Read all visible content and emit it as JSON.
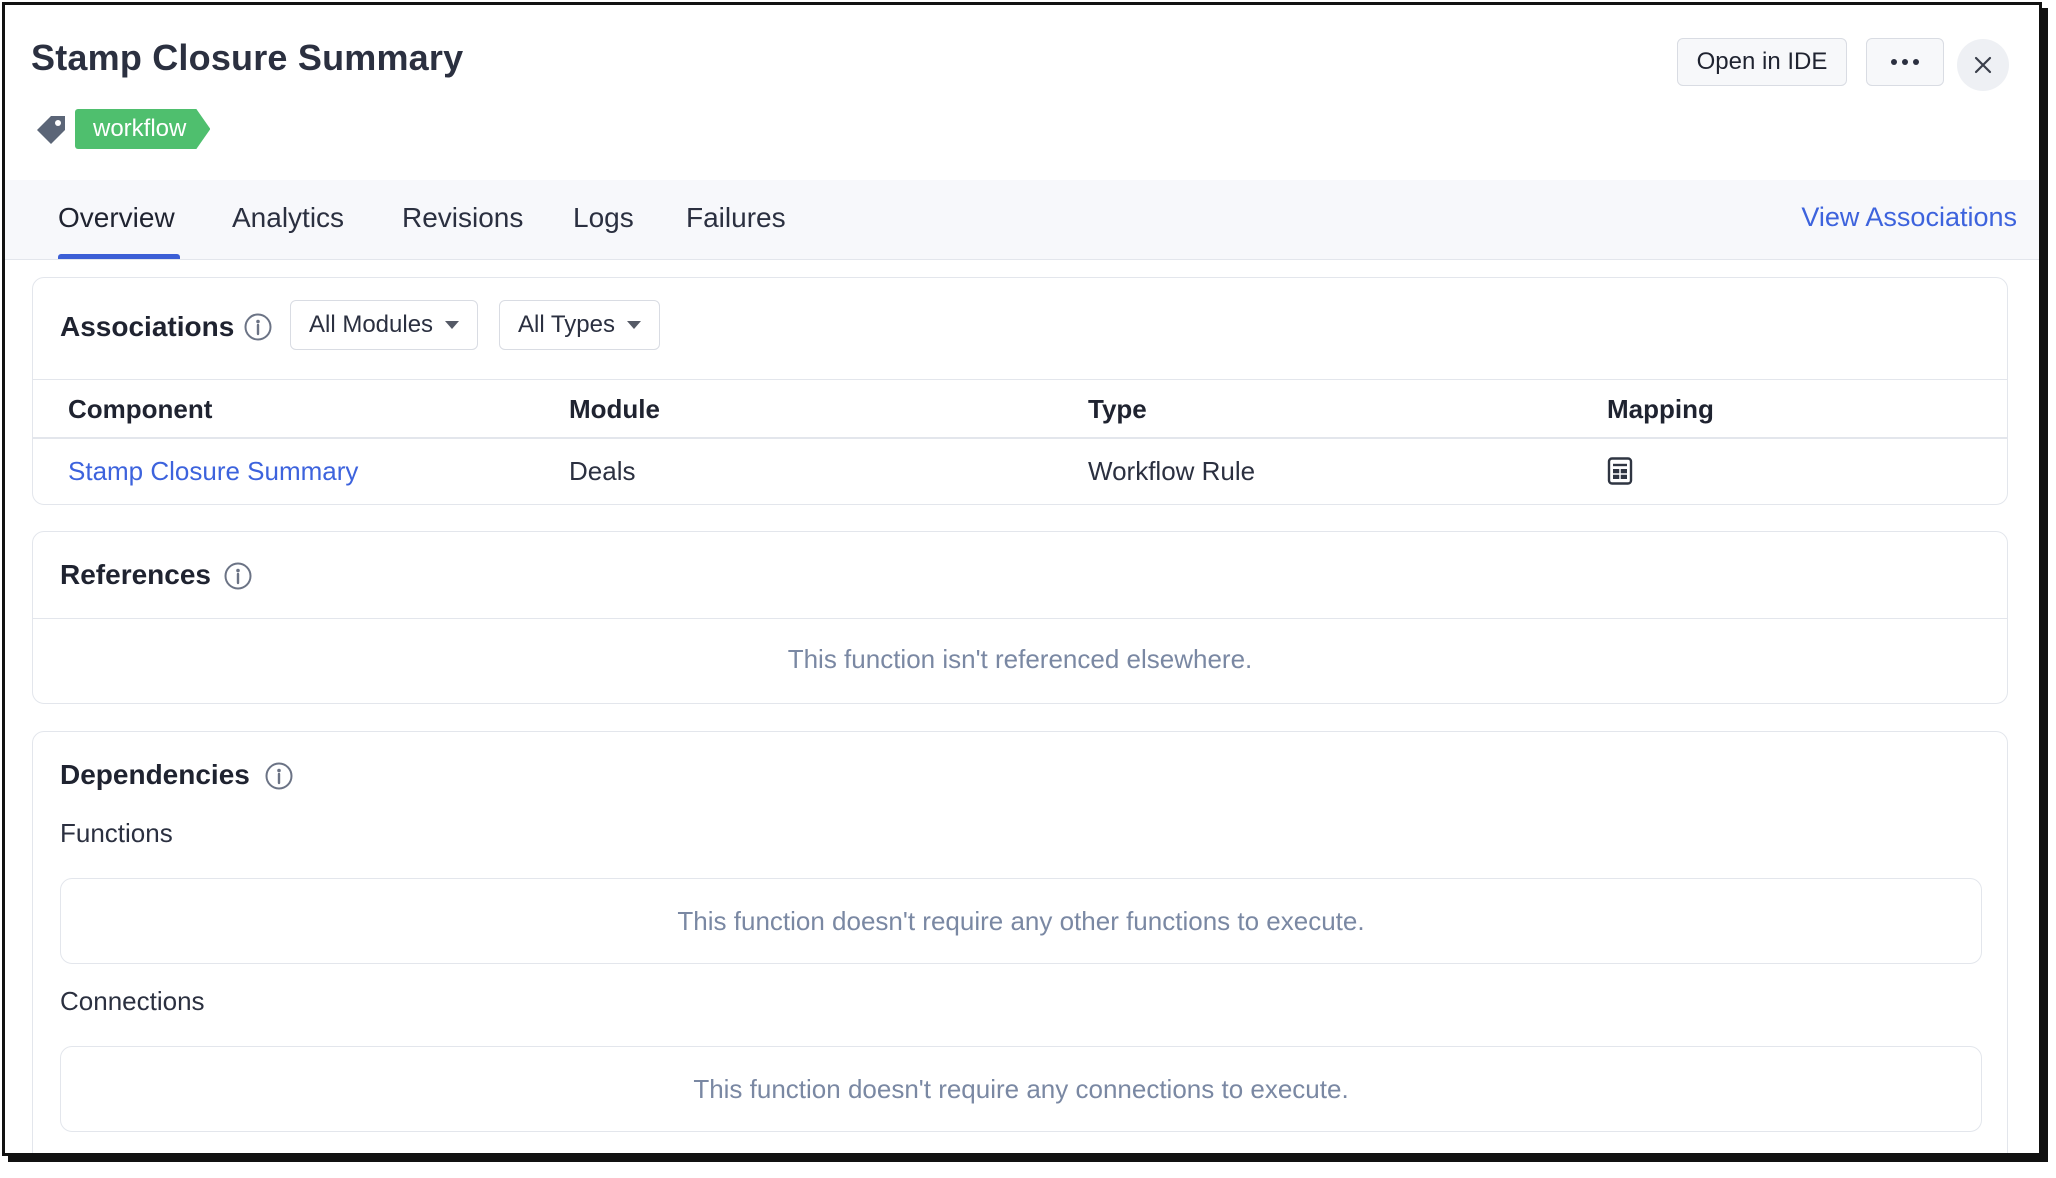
{
  "header": {
    "title": "Stamp Closure Summary",
    "tag": "workflow",
    "tag_color": "#4fbf6e",
    "open_ide_label": "Open in IDE",
    "more_icon": "more-horizontal-icon",
    "close_icon": "close-icon"
  },
  "tabs": [
    {
      "label": "Overview",
      "active": true
    },
    {
      "label": "Analytics",
      "active": false
    },
    {
      "label": "Revisions",
      "active": false
    },
    {
      "label": "Logs",
      "active": false
    },
    {
      "label": "Failures",
      "active": false
    }
  ],
  "view_associations_label": "View Associations",
  "accent_color": "#3d63dd",
  "associations": {
    "title": "Associations",
    "filter_modules": "All Modules",
    "filter_types": "All Types",
    "columns": [
      "Component",
      "Module",
      "Type",
      "Mapping"
    ],
    "rows": [
      {
        "component": "Stamp Closure Summary",
        "module": "Deals",
        "type": "Workflow Rule",
        "mapping_icon": "spreadsheet-icon"
      }
    ]
  },
  "references": {
    "title": "References",
    "empty_message": "This function isn't referenced elsewhere."
  },
  "dependencies": {
    "title": "Dependencies",
    "functions_label": "Functions",
    "functions_empty": "This function doesn't require any other functions to execute.",
    "connections_label": "Connections",
    "connections_empty": "This function doesn't require any connections to execute."
  }
}
